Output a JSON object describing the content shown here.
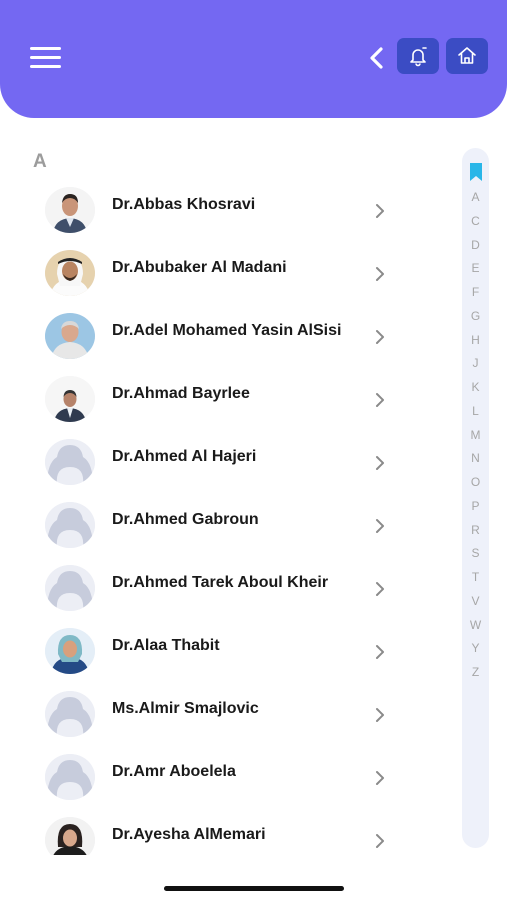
{
  "header": {
    "menu_icon": "hamburger-menu-icon",
    "back_icon": "chevron-left-icon",
    "notification_icon": "bell-icon",
    "home_icon": "home-icon",
    "background_color": "#7468f2",
    "button_color": "#3b4cc4"
  },
  "section_letter": "A",
  "doctors": [
    {
      "name": "Dr.Abbas Khosravi",
      "avatar": "photo"
    },
    {
      "name": "Dr.Abubaker Al Madani",
      "avatar": "photo"
    },
    {
      "name": "Dr.Adel Mohamed Yasin AlSisi",
      "avatar": "photo"
    },
    {
      "name": "Dr.Ahmad Bayrlee",
      "avatar": "photo"
    },
    {
      "name": "Dr.Ahmed Al Hajeri",
      "avatar": "placeholder"
    },
    {
      "name": "Dr.Ahmed Gabroun",
      "avatar": "placeholder"
    },
    {
      "name": "Dr.Ahmed Tarek Aboul Kheir",
      "avatar": "placeholder"
    },
    {
      "name": "Dr.Alaa Thabit",
      "avatar": "photo"
    },
    {
      "name": "Ms.Almir Smajlovic",
      "avatar": "placeholder"
    },
    {
      "name": "Dr.Amr Aboelela",
      "avatar": "placeholder"
    },
    {
      "name": "Dr.Ayesha AlMemari",
      "avatar": "photo"
    }
  ],
  "index_bar": {
    "bookmark_icon": "bookmark-icon",
    "letters": [
      "A",
      "C",
      "D",
      "E",
      "F",
      "G",
      "H",
      "J",
      "K",
      "L",
      "M",
      "N",
      "O",
      "P",
      "R",
      "S",
      "T",
      "V",
      "W",
      "Y",
      "Z"
    ]
  }
}
